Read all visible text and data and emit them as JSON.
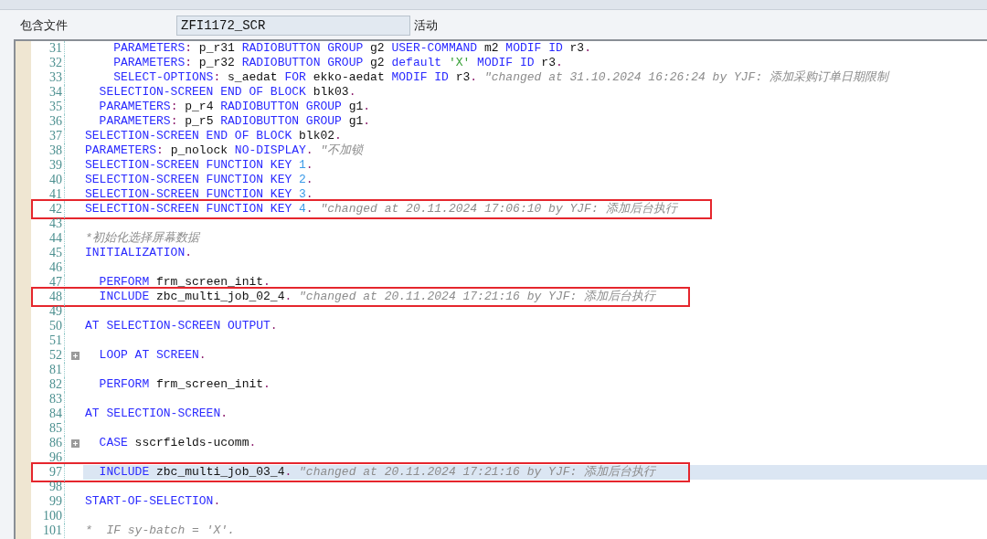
{
  "header": {
    "label": "包含文件",
    "program": "ZFI1172_SCR",
    "status": "活动"
  },
  "editor": {
    "lines": [
      {
        "number": "31",
        "folded": false,
        "framed": false,
        "selected": false,
        "tokens": [
          {
            "kind": "keyword",
            "text": "    PARAMETERS"
          },
          {
            "kind": "symbol",
            "text": ":"
          },
          {
            "kind": "name",
            "text": " p_r31 "
          },
          {
            "kind": "keyword",
            "text": "RADIOBUTTON GROUP"
          },
          {
            "kind": "name",
            "text": " g2 "
          },
          {
            "kind": "keyword",
            "text": "USER-COMMAND"
          },
          {
            "kind": "name",
            "text": " m2 "
          },
          {
            "kind": "keyword",
            "text": "MODIF ID"
          },
          {
            "kind": "name",
            "text": " r3"
          },
          {
            "kind": "symbol",
            "text": "."
          }
        ]
      },
      {
        "number": "32",
        "folded": false,
        "framed": false,
        "selected": false,
        "tokens": [
          {
            "kind": "keyword",
            "text": "    PARAMETERS"
          },
          {
            "kind": "symbol",
            "text": ":"
          },
          {
            "kind": "name",
            "text": " p_r32 "
          },
          {
            "kind": "keyword",
            "text": "RADIOBUTTON GROUP"
          },
          {
            "kind": "name",
            "text": " g2 "
          },
          {
            "kind": "keyword",
            "text": "default "
          },
          {
            "kind": "string",
            "text": "'X'"
          },
          {
            "kind": "keyword",
            "text": " MODIF ID"
          },
          {
            "kind": "name",
            "text": " r3"
          },
          {
            "kind": "symbol",
            "text": "."
          }
        ]
      },
      {
        "number": "33",
        "folded": false,
        "framed": false,
        "selected": false,
        "tokens": [
          {
            "kind": "keyword",
            "text": "    SELECT-OPTIONS"
          },
          {
            "kind": "symbol",
            "text": ":"
          },
          {
            "kind": "name",
            "text": " s_aedat "
          },
          {
            "kind": "keyword",
            "text": "FOR"
          },
          {
            "kind": "name",
            "text": " ekko-aedat "
          },
          {
            "kind": "keyword",
            "text": "MODIF ID"
          },
          {
            "kind": "name",
            "text": " r3"
          },
          {
            "kind": "symbol",
            "text": "."
          }
        ],
        "comment": "\"changed at 31.10.2024 16:26:24 by YJF: 添加采购订单日期限制"
      },
      {
        "number": "34",
        "folded": false,
        "framed": false,
        "selected": false,
        "tokens": [
          {
            "kind": "keyword",
            "text": "  SELECTION-SCREEN END OF BLOCK"
          },
          {
            "kind": "name",
            "text": " blk03"
          },
          {
            "kind": "symbol",
            "text": "."
          }
        ]
      },
      {
        "number": "35",
        "folded": false,
        "framed": false,
        "selected": false,
        "tokens": [
          {
            "kind": "keyword",
            "text": "  PARAMETERS"
          },
          {
            "kind": "symbol",
            "text": ":"
          },
          {
            "kind": "name",
            "text": " p_r4 "
          },
          {
            "kind": "keyword",
            "text": "RADIOBUTTON GROUP"
          },
          {
            "kind": "name",
            "text": " g1"
          },
          {
            "kind": "symbol",
            "text": "."
          }
        ]
      },
      {
        "number": "36",
        "folded": false,
        "framed": false,
        "selected": false,
        "tokens": [
          {
            "kind": "keyword",
            "text": "  PARAMETERS"
          },
          {
            "kind": "symbol",
            "text": ":"
          },
          {
            "kind": "name",
            "text": " p_r5 "
          },
          {
            "kind": "keyword",
            "text": "RADIOBUTTON GROUP"
          },
          {
            "kind": "name",
            "text": " g1"
          },
          {
            "kind": "symbol",
            "text": "."
          }
        ]
      },
      {
        "number": "37",
        "folded": false,
        "framed": false,
        "selected": false,
        "tokens": [
          {
            "kind": "keyword",
            "text": "SELECTION-SCREEN END OF BLOCK"
          },
          {
            "kind": "name",
            "text": " blk02"
          },
          {
            "kind": "symbol",
            "text": "."
          }
        ]
      },
      {
        "number": "38",
        "folded": false,
        "framed": false,
        "selected": false,
        "tokens": [
          {
            "kind": "keyword",
            "text": "PARAMETERS"
          },
          {
            "kind": "symbol",
            "text": ":"
          },
          {
            "kind": "name",
            "text": " p_nolock "
          },
          {
            "kind": "keyword",
            "text": "NO-DISPLAY"
          },
          {
            "kind": "symbol",
            "text": "."
          }
        ],
        "comment": "\"不加锁"
      },
      {
        "number": "39",
        "folded": false,
        "framed": false,
        "selected": false,
        "tokens": [
          {
            "kind": "keyword",
            "text": "SELECTION-SCREEN FUNCTION KEY "
          },
          {
            "kind": "number",
            "text": "1"
          },
          {
            "kind": "symbol",
            "text": "."
          }
        ]
      },
      {
        "number": "40",
        "folded": false,
        "framed": false,
        "selected": false,
        "tokens": [
          {
            "kind": "keyword",
            "text": "SELECTION-SCREEN FUNCTION KEY "
          },
          {
            "kind": "number",
            "text": "2"
          },
          {
            "kind": "symbol",
            "text": "."
          }
        ]
      },
      {
        "number": "41",
        "folded": false,
        "framed": false,
        "selected": false,
        "tokens": [
          {
            "kind": "keyword",
            "text": "SELECTION-SCREEN FUNCTION KEY "
          },
          {
            "kind": "number",
            "text": "3"
          },
          {
            "kind": "symbol",
            "text": "."
          }
        ]
      },
      {
        "number": "42",
        "folded": false,
        "framed": true,
        "selected": false,
        "tokens": [
          {
            "kind": "keyword",
            "text": "SELECTION-SCREEN FUNCTION KEY "
          },
          {
            "kind": "number",
            "text": "4"
          },
          {
            "kind": "symbol",
            "text": "."
          }
        ],
        "comment": "\"changed at 20.11.2024 17:06:10 by YJF: 添加后台执行"
      },
      {
        "number": "43",
        "folded": false,
        "framed": false,
        "selected": false
      },
      {
        "number": "44",
        "folded": false,
        "framed": false,
        "selected": false,
        "comment": "*初始化选择屏幕数据"
      },
      {
        "number": "45",
        "folded": false,
        "framed": false,
        "selected": false,
        "tokens": [
          {
            "kind": "keyword",
            "text": "INITIALIZATION"
          },
          {
            "kind": "symbol",
            "text": "."
          }
        ]
      },
      {
        "number": "46",
        "folded": false,
        "framed": false,
        "selected": false
      },
      {
        "number": "47",
        "folded": false,
        "framed": false,
        "selected": false,
        "tokens": [
          {
            "kind": "keyword",
            "text": "  PERFORM"
          },
          {
            "kind": "name",
            "text": " frm_screen_init"
          },
          {
            "kind": "symbol",
            "text": "."
          }
        ]
      },
      {
        "number": "48",
        "folded": false,
        "framed": true,
        "selected": false,
        "tokens": [
          {
            "kind": "keyword",
            "text": "  INCLUDE"
          },
          {
            "kind": "name",
            "text": " zbc_multi_job_02_4"
          },
          {
            "kind": "symbol",
            "text": "."
          }
        ],
        "comment": "\"changed at 20.11.2024 17:21:16 by YJF: 添加后台执行"
      },
      {
        "number": "49",
        "folded": false,
        "framed": false,
        "selected": false
      },
      {
        "number": "50",
        "folded": false,
        "framed": false,
        "selected": false,
        "tokens": [
          {
            "kind": "keyword",
            "text": "AT SELECTION-SCREEN OUTPUT"
          },
          {
            "kind": "symbol",
            "text": "."
          }
        ]
      },
      {
        "number": "51",
        "folded": false,
        "framed": false,
        "selected": false
      },
      {
        "number": "52",
        "folded": true,
        "framed": false,
        "selected": false,
        "tokens": [
          {
            "kind": "keyword",
            "text": "  LOOP AT SCREEN"
          },
          {
            "kind": "symbol",
            "text": "."
          }
        ]
      },
      {
        "number": "81",
        "folded": false,
        "framed": false,
        "selected": false
      },
      {
        "number": "82",
        "folded": false,
        "framed": false,
        "selected": false,
        "tokens": [
          {
            "kind": "keyword",
            "text": "  PERFORM"
          },
          {
            "kind": "name",
            "text": " frm_screen_init"
          },
          {
            "kind": "symbol",
            "text": "."
          }
        ]
      },
      {
        "number": "83",
        "folded": false,
        "framed": false,
        "selected": false
      },
      {
        "number": "84",
        "folded": false,
        "framed": false,
        "selected": false,
        "tokens": [
          {
            "kind": "keyword",
            "text": "AT SELECTION-SCREEN"
          },
          {
            "kind": "symbol",
            "text": "."
          }
        ]
      },
      {
        "number": "85",
        "folded": false,
        "framed": false,
        "selected": false
      },
      {
        "number": "86",
        "folded": true,
        "framed": false,
        "selected": false,
        "tokens": [
          {
            "kind": "keyword",
            "text": "  CASE"
          },
          {
            "kind": "name",
            "text": " sscrfields-ucomm"
          },
          {
            "kind": "symbol",
            "text": "."
          }
        ]
      },
      {
        "number": "96",
        "folded": false,
        "framed": false,
        "selected": false
      },
      {
        "number": "97",
        "folded": false,
        "framed": true,
        "selected": true,
        "tokens": [
          {
            "kind": "keyword",
            "text": "  INCLUDE"
          },
          {
            "kind": "name",
            "text": " zbc_multi_job_03_4"
          },
          {
            "kind": "symbol",
            "text": "."
          }
        ],
        "comment": "\"changed at 20.11.2024 17:21:16 by YJF: 添加后台执行"
      },
      {
        "number": "98",
        "folded": false,
        "framed": false,
        "selected": false
      },
      {
        "number": "99",
        "folded": false,
        "framed": false,
        "selected": false,
        "tokens": [
          {
            "kind": "keyword",
            "text": "START-OF-SELECTION"
          },
          {
            "kind": "symbol",
            "text": "."
          }
        ]
      },
      {
        "number": "100",
        "folded": false,
        "framed": false,
        "selected": false
      },
      {
        "number": "101",
        "folded": false,
        "framed": false,
        "selected": false,
        "comment": "*  IF sy-batch = 'X'."
      }
    ]
  }
}
